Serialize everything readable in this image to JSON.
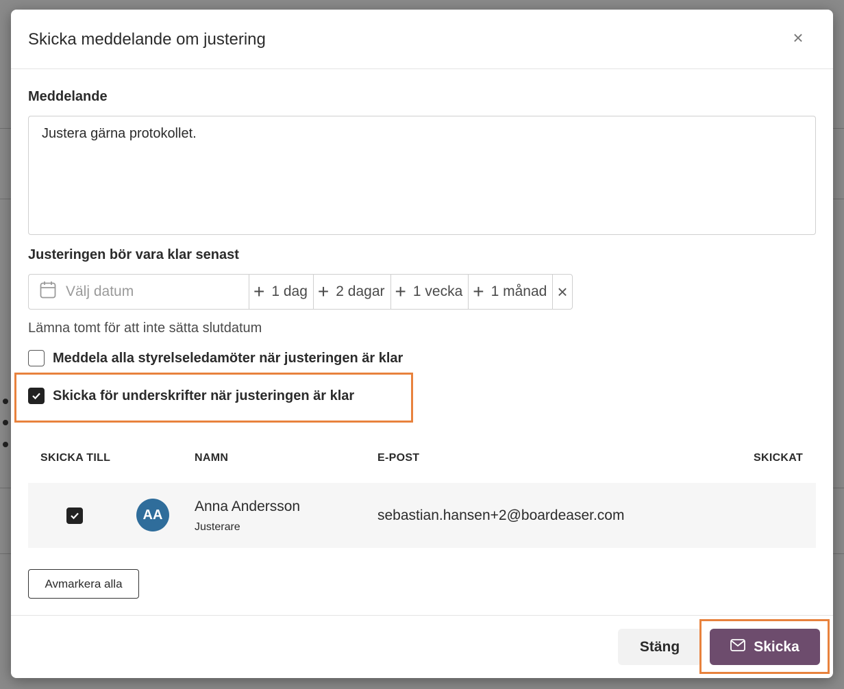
{
  "modal": {
    "title": "Skicka meddelande om justering",
    "close_symbol": "×"
  },
  "message": {
    "label": "Meddelande",
    "value": "Justera gärna protokollet."
  },
  "deadline": {
    "label": "Justeringen bör vara klar senast",
    "placeholder": "Välj datum",
    "icon": "calendar-icon",
    "quick_options": [
      "1 dag",
      "2 dagar",
      "1 vecka",
      "1 månad"
    ],
    "clear_symbol": "×",
    "hint": "Lämna tomt för att inte sätta slutdatum"
  },
  "options": {
    "notify_all": {
      "label": "Meddela alla styrelseledamöter när justeringen är klar",
      "checked": false
    },
    "send_for_signatures": {
      "label": "Skicka för underskrifter när justeringen är klar",
      "checked": true
    }
  },
  "table": {
    "headers": {
      "send_to": "SKICKA TILL",
      "name": "NAMN",
      "email": "E-POST",
      "sent": "SKICKAT"
    },
    "rows": [
      {
        "checked": true,
        "initials": "AA",
        "name": "Anna Andersson",
        "role": "Justerare",
        "email": "sebastian.hansen+2@boardeaser.com",
        "sent": ""
      }
    ]
  },
  "buttons": {
    "deselect_all": "Avmarkera alla",
    "close": "Stäng",
    "send": "Skicka"
  },
  "colors": {
    "primary": "#6d4c6d",
    "avatar": "#2f6d9b",
    "highlight": "#e8823d"
  }
}
